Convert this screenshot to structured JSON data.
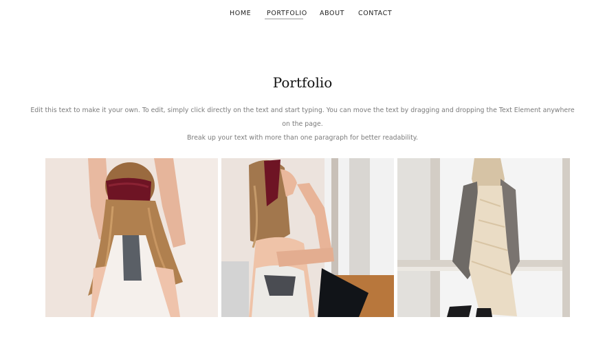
{
  "nav": {
    "items": [
      {
        "label": "HOME"
      },
      {
        "label": "PORTFOLIO"
      },
      {
        "label": "ABOUT"
      },
      {
        "label": "CONTACT"
      }
    ],
    "active": "PORTFOLIO"
  },
  "page": {
    "title": "Portfolio",
    "description_line1": "Edit this text to make it your own. To edit, simply click directly on the text and start typing. You can move the text by dragging and dropping the Text Element anywhere on the page.",
    "description_line2": "Break up your text with more than one paragraph for better readability."
  },
  "gallery": {
    "images": [
      {
        "name": "woman-red-headband-back-view"
      },
      {
        "name": "woman-red-headband-seated-profile"
      },
      {
        "name": "woman-cream-dress-cardigan-window"
      }
    ]
  },
  "colors": {
    "text": "#1f1f1f",
    "muted": "#7b7b7b",
    "accent_headband": "#6e1424",
    "background": "#ffffff"
  }
}
